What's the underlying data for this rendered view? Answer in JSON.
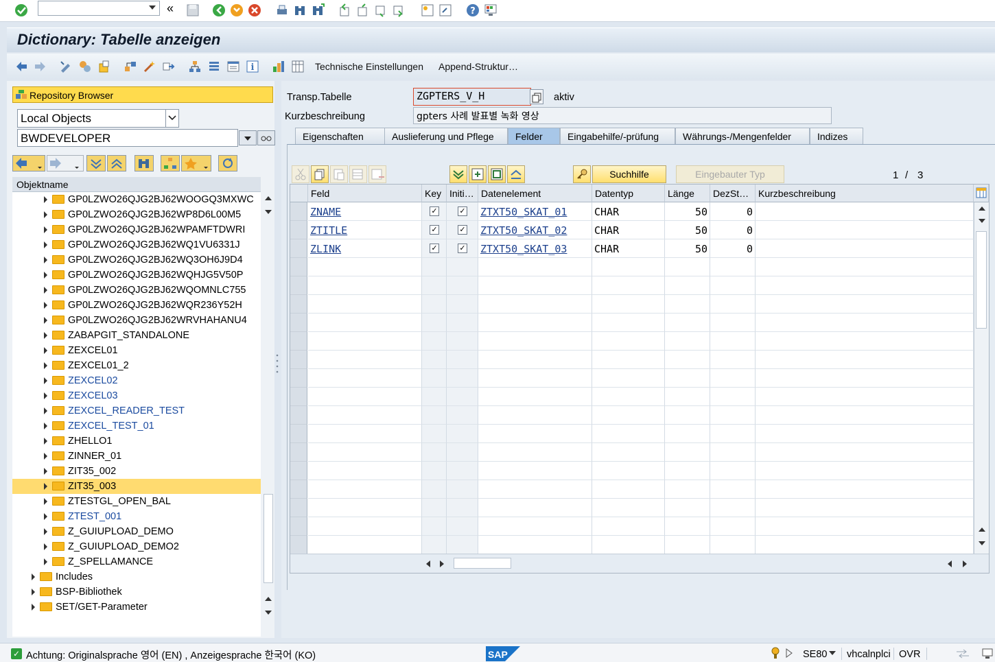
{
  "toolbar": {
    "command_field": ""
  },
  "title": "Dictionary: Tabelle anzeigen",
  "app_toolbar": {
    "tech_settings": "Technische Einstellungen",
    "append": "Append-Struktur…"
  },
  "left": {
    "repo_browser": "Repository Browser",
    "object_type": "Local Objects",
    "user": "BWDEVELOPER",
    "tree_header": "Objektname",
    "items": [
      {
        "label": "GP0LZWO26QJG2BJ62WOOGQ3MXWC",
        "level": 2,
        "blue": false
      },
      {
        "label": "GP0LZWO26QJG2BJ62WP8D6L00M5",
        "level": 2,
        "blue": false
      },
      {
        "label": "GP0LZWO26QJG2BJ62WPAMFTDWRI",
        "level": 2,
        "blue": false
      },
      {
        "label": "GP0LZWO26QJG2BJ62WQ1VU6331J",
        "level": 2,
        "blue": false
      },
      {
        "label": "GP0LZWO26QJG2BJ62WQ3OH6J9D4",
        "level": 2,
        "blue": false
      },
      {
        "label": "GP0LZWO26QJG2BJ62WQHJG5V50P",
        "level": 2,
        "blue": false
      },
      {
        "label": "GP0LZWO26QJG2BJ62WQOMNLC755",
        "level": 2,
        "blue": false
      },
      {
        "label": "GP0LZWO26QJG2BJ62WQR236Y52H",
        "level": 2,
        "blue": false
      },
      {
        "label": "GP0LZWO26QJG2BJ62WRVHAHANU4",
        "level": 2,
        "blue": false
      },
      {
        "label": "ZABAPGIT_STANDALONE",
        "level": 2,
        "blue": false
      },
      {
        "label": "ZEXCEL01",
        "level": 2,
        "blue": false
      },
      {
        "label": "ZEXCEL01_2",
        "level": 2,
        "blue": false
      },
      {
        "label": "ZEXCEL02",
        "level": 2,
        "blue": true
      },
      {
        "label": "ZEXCEL03",
        "level": 2,
        "blue": true
      },
      {
        "label": "ZEXCEL_READER_TEST",
        "level": 2,
        "blue": true
      },
      {
        "label": "ZEXCEL_TEST_01",
        "level": 2,
        "blue": true
      },
      {
        "label": "ZHELLO1",
        "level": 2,
        "blue": false
      },
      {
        "label": "ZINNER_01",
        "level": 2,
        "blue": false
      },
      {
        "label": "ZIT35_002",
        "level": 2,
        "blue": false
      },
      {
        "label": "ZIT35_003",
        "level": 2,
        "blue": false,
        "selected": true
      },
      {
        "label": "ZTESTGL_OPEN_BAL",
        "level": 2,
        "blue": false
      },
      {
        "label": "ZTEST_001",
        "level": 2,
        "blue": true
      },
      {
        "label": "Z_GUIUPLOAD_DEMO",
        "level": 2,
        "blue": false
      },
      {
        "label": "Z_GUIUPLOAD_DEMO2",
        "level": 2,
        "blue": false
      },
      {
        "label": "Z_SPELLAMANCE",
        "level": 2,
        "blue": false
      },
      {
        "label": "Includes",
        "level": 1,
        "blue": false
      },
      {
        "label": "BSP-Bibliothek",
        "level": 1,
        "blue": false
      },
      {
        "label": "SET/GET-Parameter",
        "level": 1,
        "blue": false
      }
    ]
  },
  "header": {
    "label_table": "Transp.Tabelle",
    "table_name": "ZGPTERS_V_H",
    "status": "aktiv",
    "label_desc": "Kurzbeschreibung",
    "desc": "gpters 사례 발표별 녹화 영상"
  },
  "tabs": [
    "Eigenschaften",
    "Auslieferung und Pflege",
    "Felder",
    "Eingabehilfe/-prüfung",
    "Währungs-/Mengenfelder",
    "Indizes"
  ],
  "active_tab": "Felder",
  "field_toolbar": {
    "search_help": "Suchhilfe",
    "builtin_type": "Eingebauter Typ",
    "page": "1",
    "page_sep": "/",
    "page_total": "3"
  },
  "grid": {
    "columns": [
      "Feld",
      "Key",
      "Initi…",
      "Datenelement",
      "Datentyp",
      "Länge",
      "DezSt…",
      "Kurzbeschreibung"
    ],
    "rows": [
      {
        "feld": "ZNAME",
        "key": true,
        "init": true,
        "datenelement": "ZTXT50_SKAT_01",
        "datentyp": "CHAR",
        "laenge": "50",
        "dezst": "0",
        "kurz": ""
      },
      {
        "feld": "ZTITLE",
        "key": true,
        "init": true,
        "datenelement": "ZTXT50_SKAT_02",
        "datentyp": "CHAR",
        "laenge": "50",
        "dezst": "0",
        "kurz": ""
      },
      {
        "feld": "ZLINK",
        "key": true,
        "init": true,
        "datenelement": "ZTXT50_SKAT_03",
        "datentyp": "CHAR",
        "laenge": "50",
        "dezst": "0",
        "kurz": ""
      }
    ]
  },
  "status_bar": {
    "message": "Achtung: Originalsprache 영어 (EN) , Anzeigesprache 한국어 (KO)",
    "logo": "SAP",
    "transaction": "SE80",
    "server": "vhcalnplci",
    "mode": "OVR"
  },
  "colors": {
    "accent_yellow": "#ffdb4d",
    "selected_tab": "#a8c7e8",
    "link_blue": "#1a4a9f"
  }
}
